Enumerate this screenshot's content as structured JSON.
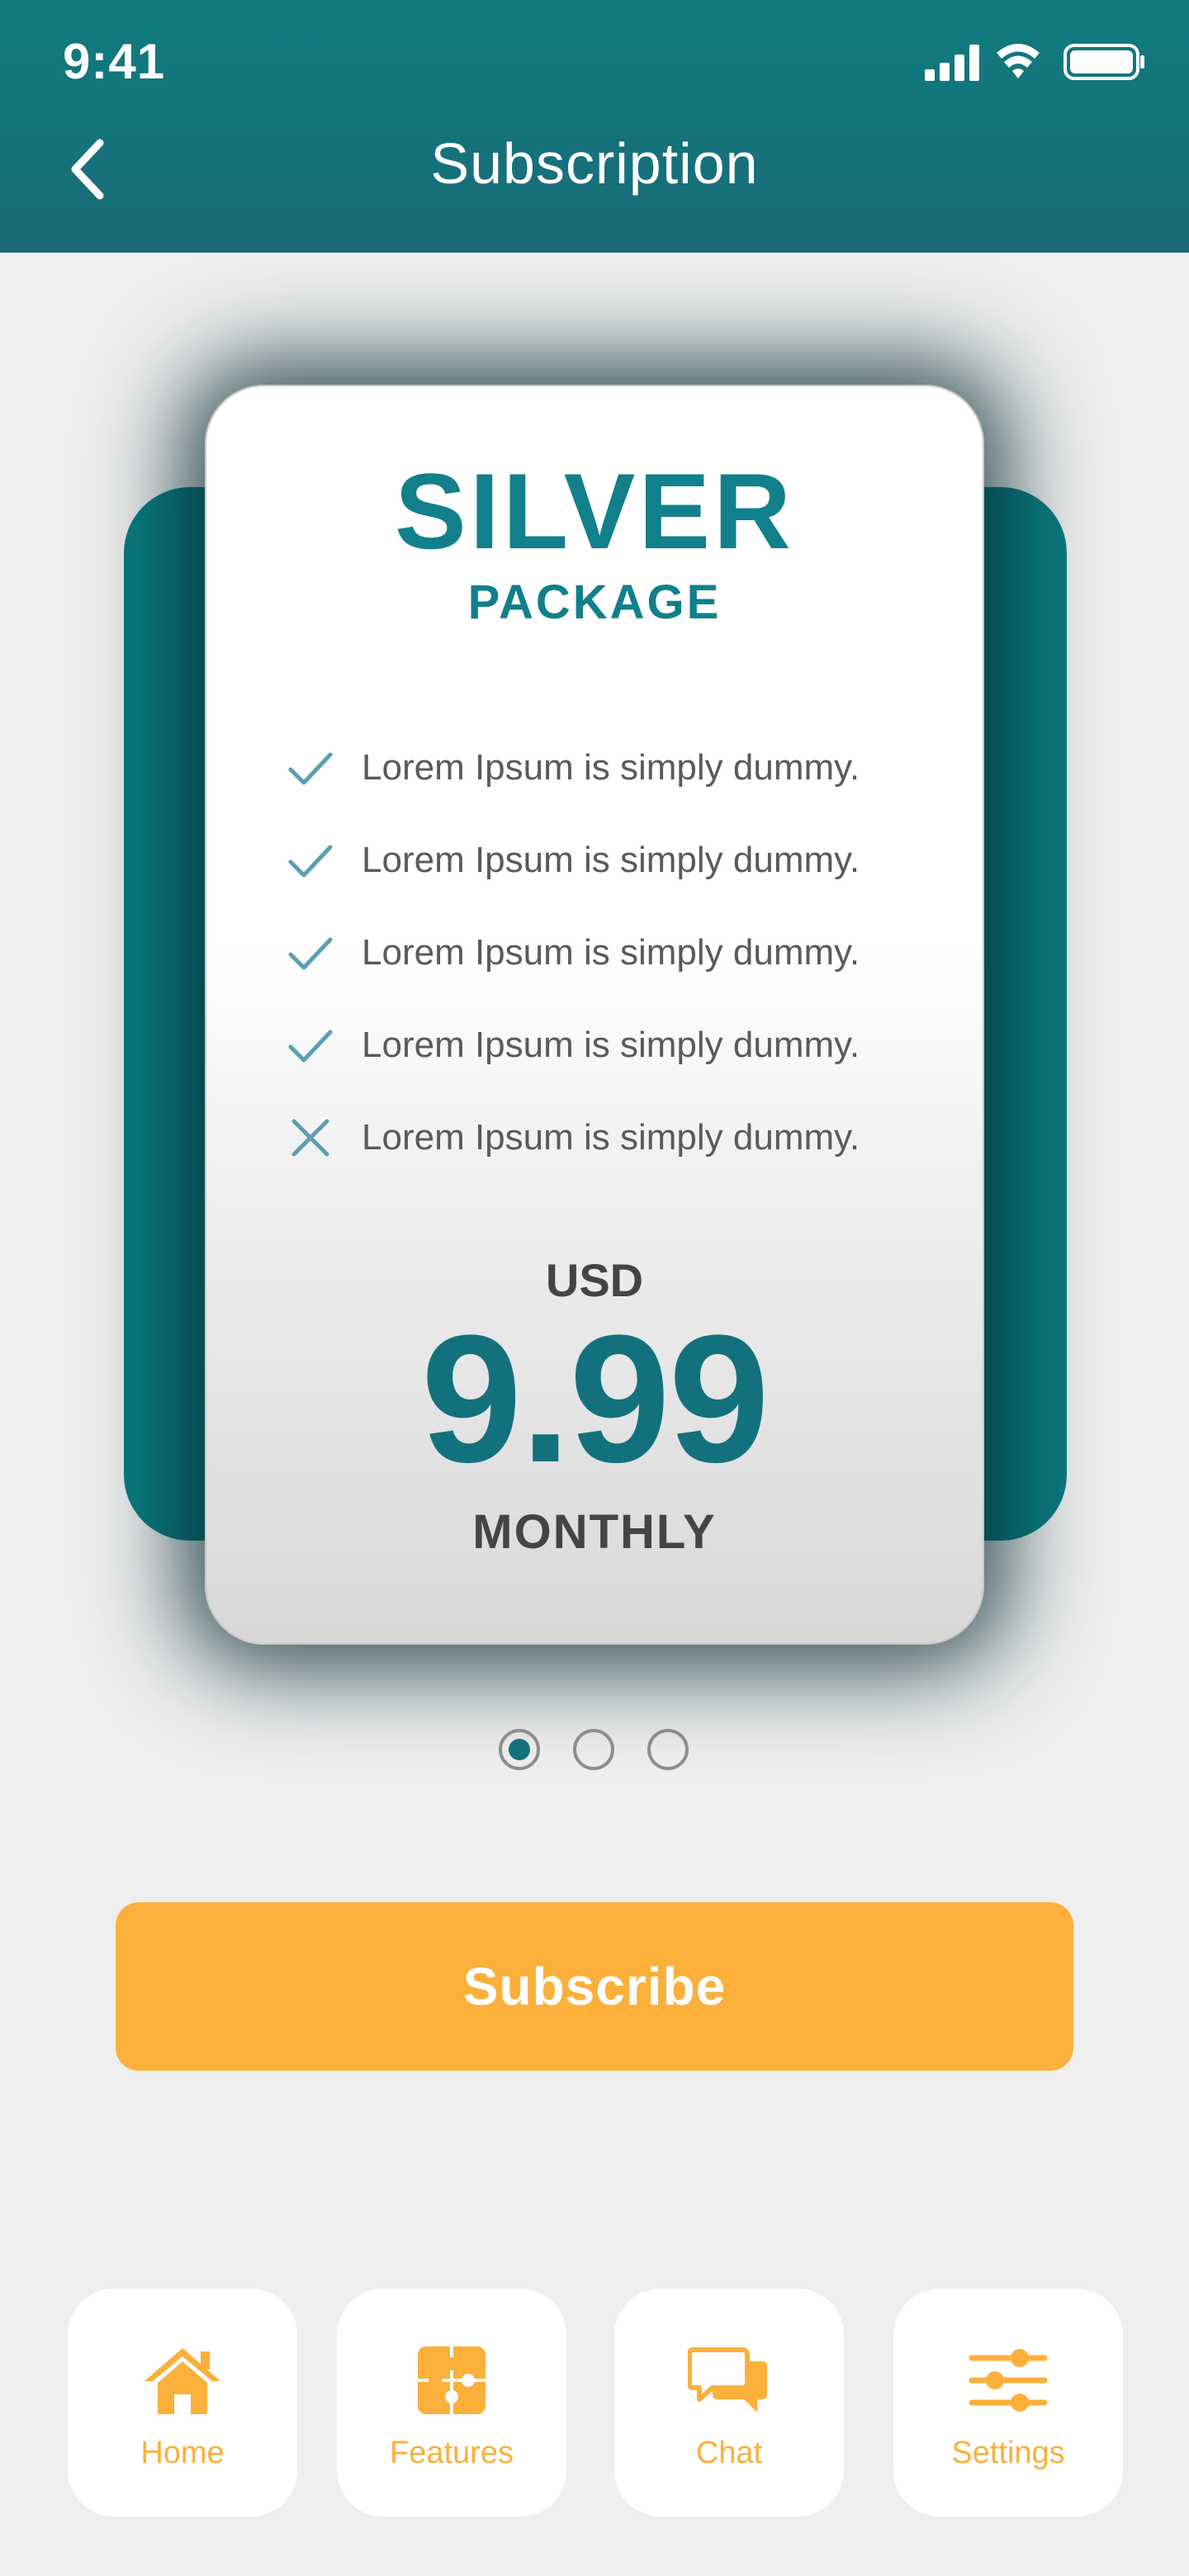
{
  "status_bar": {
    "time": "9:41",
    "icons": [
      "cellular-signal-icon",
      "wifi-icon",
      "battery-icon"
    ]
  },
  "header": {
    "title": "Subscription",
    "back_icon": "chevron-left-icon",
    "background": "#13737c"
  },
  "plan": {
    "name": "SILVER",
    "subtitle": "PACKAGE",
    "features": [
      {
        "text": "Lorem Ipsum is simply dummy.",
        "included": true
      },
      {
        "text": "Lorem Ipsum is simply dummy.",
        "included": true
      },
      {
        "text": "Lorem Ipsum is simply dummy.",
        "included": true
      },
      {
        "text": "Lorem Ipsum is simply dummy.",
        "included": true
      },
      {
        "text": "Lorem Ipsum is simply dummy.",
        "included": false
      }
    ],
    "currency": "USD",
    "price": "9.99",
    "period": "MONTHLY"
  },
  "pagination": {
    "total": 3,
    "active_index": 0
  },
  "subscribe_button": {
    "label": "Subscribe"
  },
  "bottom_nav": {
    "items": [
      {
        "label": "Home",
        "icon": "home-icon"
      },
      {
        "label": "Features",
        "icon": "puzzle-icon"
      },
      {
        "label": "Chat",
        "icon": "chat-icon"
      },
      {
        "label": "Settings",
        "icon": "sliders-icon"
      }
    ]
  },
  "colors": {
    "primary": "#0f7b7f",
    "accent": "#fbb03b",
    "text_dark": "#444444",
    "background": "#efefef"
  }
}
